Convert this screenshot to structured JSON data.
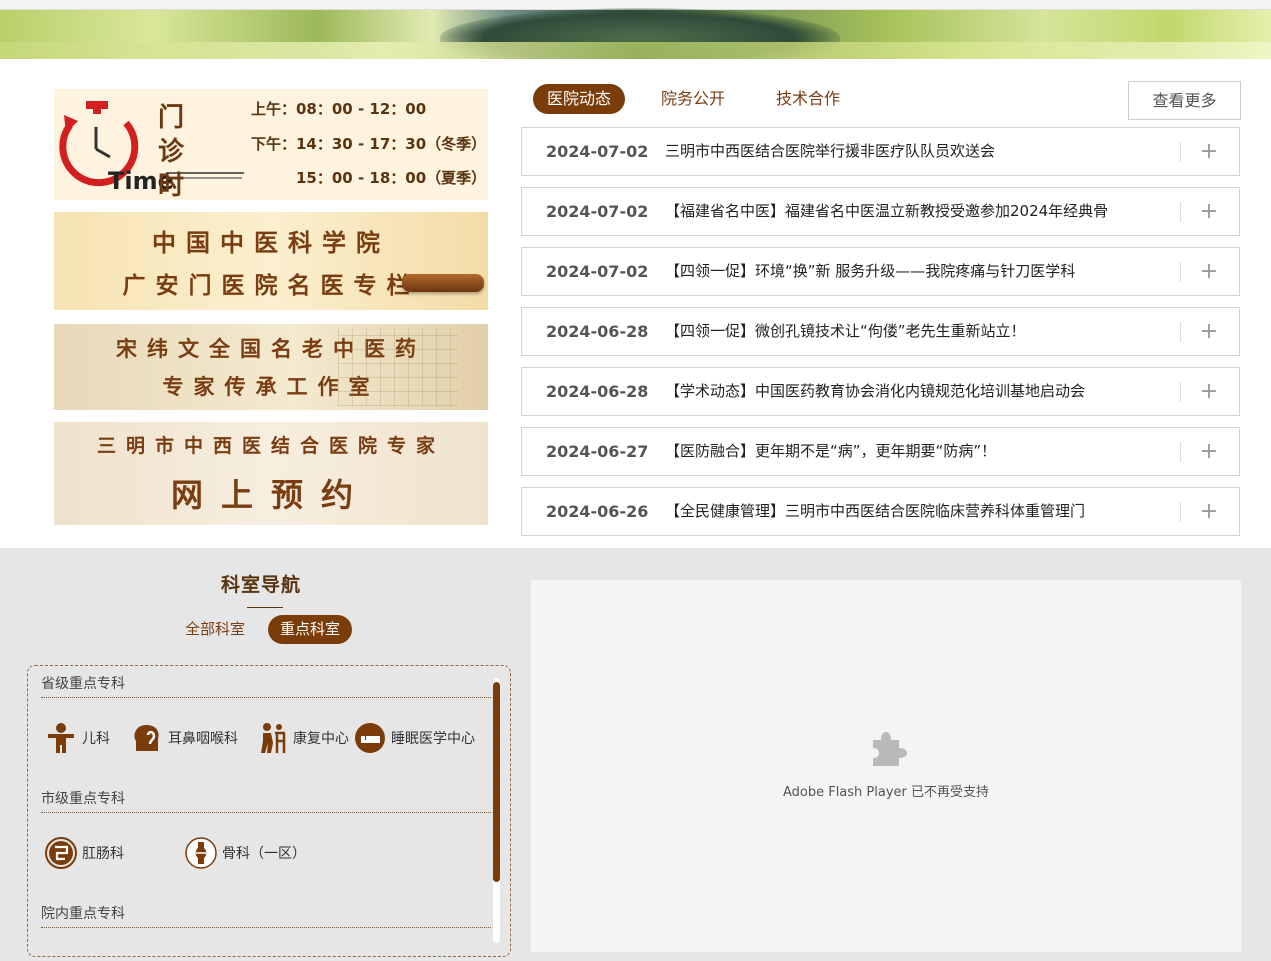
{
  "clinic": {
    "title": "门 诊 时 间",
    "time_word": "Time",
    "morning": "上午：08：00 - 12：00",
    "afternoon_winter": "下午：14：30 - 17：30（冬季）",
    "afternoon_summer": "15：00 - 18：00（夏季）"
  },
  "panels": {
    "p2_line1": "中国中医科学院",
    "p2_line2": "广安门医院名医专栏",
    "p3_line1": "宋纬文全国名老中医药",
    "p3_line2": "专家传承工作室",
    "p4_line1": "三明市中西医结合医院专家",
    "p4_line2": "网上预约"
  },
  "news": {
    "tabs": [
      "医院动态",
      "院务公开",
      "技术合作"
    ],
    "more_label": "查看更多",
    "items": [
      {
        "date": "2024-07-02",
        "title": "三明市中西医结合医院举行援非医疗队队员欢送会"
      },
      {
        "date": "2024-07-02",
        "title": "【福建省名中医】福建省名中医温立新教授受邀参加2024年经典骨"
      },
      {
        "date": "2024-07-02",
        "title": "【四领一促】环境“换”新 服务升级——我院疼痛与针刀医学科"
      },
      {
        "date": "2024-06-28",
        "title": "【四领一促】微创孔镜技术让“佝偻”老先生重新站立！"
      },
      {
        "date": "2024-06-28",
        "title": "【学术动态】中国医药教育协会消化内镜规范化培训基地启动会"
      },
      {
        "date": "2024-06-27",
        "title": "【医防融合】更年期不是“病”，更年期要“防病”！"
      },
      {
        "date": "2024-06-26",
        "title": "【全民健康管理】三明市中西医结合医院临床营养科体重管理门"
      }
    ],
    "plus_symbol": "+"
  },
  "departments": {
    "title": "科室导航",
    "tabs": [
      "全部科室",
      "重点科室"
    ],
    "categories": [
      {
        "label": "省级重点专科",
        "items": [
          "儿科",
          "耳鼻咽喉科",
          "康复中心",
          "睡眠医学中心"
        ]
      },
      {
        "label": "市级重点专科",
        "items": [
          "肛肠科",
          "骨科（一区）"
        ]
      },
      {
        "label": "院内重点专科",
        "items": []
      }
    ]
  },
  "flash": {
    "message": "Adobe Flash Player 已不再受支持",
    "icon": "puzzle-piece-icon"
  },
  "colors": {
    "accent": "#7a3d0a",
    "panel_bg": "#fdf3df",
    "bottom_bg": "#e6e6e6"
  }
}
